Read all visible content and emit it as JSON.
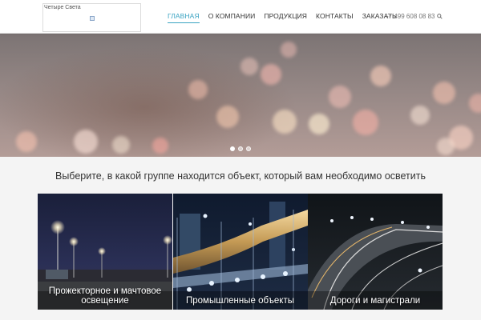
{
  "header": {
    "logo_alt": "Четыре Света",
    "nav": [
      {
        "label": "ГЛАВНАЯ",
        "active": true
      },
      {
        "label": "О КОМПАНИИ",
        "active": false
      },
      {
        "label": "ПРОДУКЦИЯ",
        "active": false
      },
      {
        "label": "КОНТАКТЫ",
        "active": false
      },
      {
        "label": "ЗАКАЗАТЬ",
        "active": false
      }
    ],
    "phone": "+7 499 608 08 83",
    "search_icon": "search-icon"
  },
  "slider": {
    "dot_count": 3,
    "active_dot": 1
  },
  "section": {
    "heading": "Выберите, в какой группе находится объект, который вам необходимо осветить",
    "cards": [
      {
        "label": "Прожекторное и мачтовое освещение"
      },
      {
        "label": "Промышленные объекты"
      },
      {
        "label": "Дороги и магистрали"
      }
    ]
  },
  "colors": {
    "accent": "#3aa3c2",
    "text": "#333333",
    "section_bg": "#f4f4f4"
  }
}
